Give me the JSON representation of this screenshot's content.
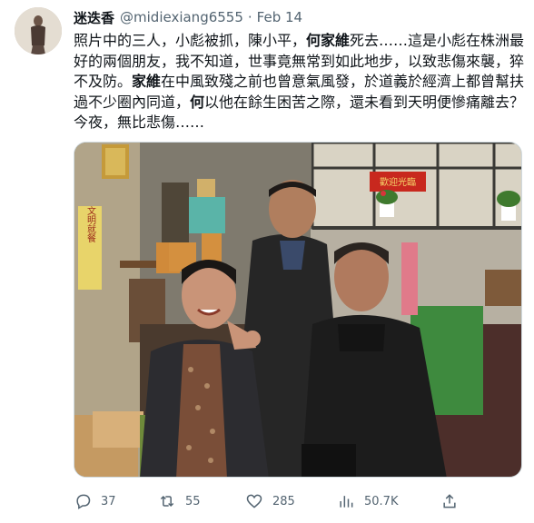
{
  "author": {
    "display_name": "迷迭香",
    "handle": "@midiexiang6555",
    "separator": "·",
    "date": "Feb 14"
  },
  "tweet_text": {
    "p1": "照片中的三人，小彪被抓，陳小平，",
    "b1": "何家維",
    "p2": "死去……這是小彪在株洲最好的兩個朋友，我不知道，世事竟無常到如此地步，以致悲傷來襲，猝不及防。",
    "b2": "家維",
    "p3": "在中風致殘之前也曾意氣風發，於道義於經濟上都曾幫扶過不少圈內同道，",
    "b3": "何",
    "p4": "以他在餘生困苦之際，還未看到天明便慘痛離去？今夜，無比悲傷……"
  },
  "photo": {
    "banner_text": "歡迎光臨",
    "sign_text": "文明就餐"
  },
  "actions": {
    "reply_count": "37",
    "retweet_count": "55",
    "like_count": "285",
    "views_count": "50.7K"
  },
  "colors": {
    "text": "#0f1419",
    "secondary": "#536471",
    "border": "#cfd9de"
  }
}
